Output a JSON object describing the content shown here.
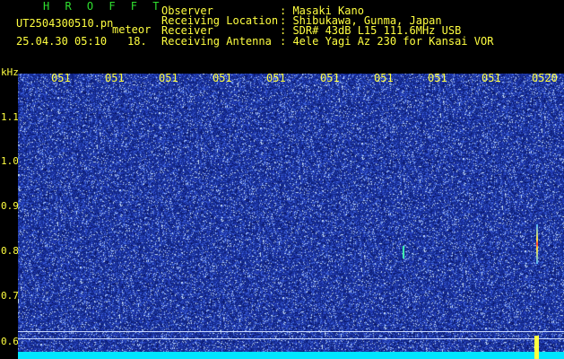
{
  "header": {
    "brand": "H R O F F T",
    "file_name": "UT2504300510.pn",
    "file_suffix": "meteor",
    "date_time": "25.04.30 05:10",
    "count": "18.",
    "fields": [
      {
        "label": "Observer",
        "value": ": Masaki Kano"
      },
      {
        "label": "Receiving Location",
        "value": ": Shibukawa, Gunma, Japan"
      },
      {
        "label": "Receiver",
        "value": ": SDR# 43dB L15 111.6MHz USB"
      },
      {
        "label": "Receiving Antenna",
        "value": ": 4ele Yagi Az 230 for Kansai VOR"
      }
    ]
  },
  "axes": {
    "y_unit": "kHz",
    "y_ticks": [
      "1.1",
      "1.0",
      "0.9",
      "0.8",
      "0.7",
      "0.6"
    ],
    "x_ticks": [
      "051",
      "051",
      "051",
      "051",
      "051",
      "051",
      "051",
      "051",
      "051",
      "0520"
    ]
  },
  "colors": {
    "text": "#ffff40",
    "brand": "#2fe02f",
    "background": "#142a8c",
    "band": "#00e5ff"
  }
}
